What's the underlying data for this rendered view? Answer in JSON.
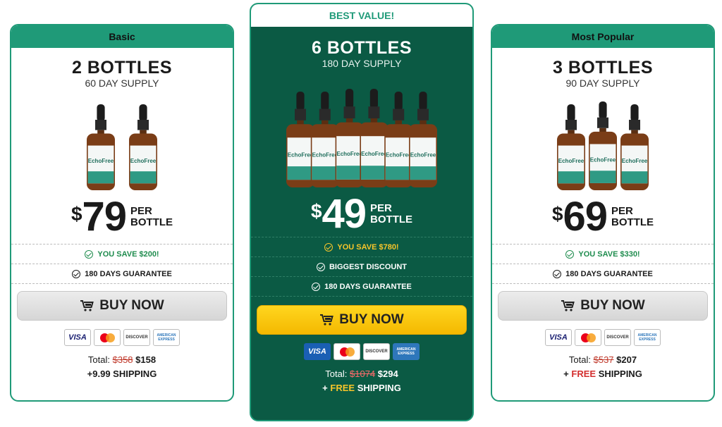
{
  "plans": {
    "basic": {
      "label": "Basic",
      "title": "2 BOTTLES",
      "supply": "60 DAY SUPPLY",
      "price_symbol": "$",
      "price": "79",
      "per1": "PER",
      "per2": "BOTTLE",
      "savings": "YOU SAVE $200!",
      "guarantee": "180 DAYS GUARANTEE",
      "buy": "BUY NOW",
      "total_label": "Total:",
      "total_old": "$358",
      "total_new": "$158",
      "shipping": "+9.99 SHIPPING",
      "bottle_count": 2
    },
    "best": {
      "label": "BEST VALUE!",
      "title": "6 BOTTLES",
      "supply": "180 DAY SUPPLY",
      "price_symbol": "$",
      "price": "49",
      "per1": "PER",
      "per2": "BOTTLE",
      "savings": "YOU SAVE $780!",
      "discount": "BIGGEST DISCOUNT",
      "guarantee": "180 DAYS GUARANTEE",
      "buy": "BUY NOW",
      "total_label": "Total:",
      "total_old": "$1074",
      "total_new": "$294",
      "shipping_plus": "+",
      "shipping_free": "FREE",
      "shipping_word": "SHIPPING",
      "bottle_count": 6
    },
    "popular": {
      "label": "Most Popular",
      "title": "3 BOTTLES",
      "supply": "90 DAY SUPPLY",
      "price_symbol": "$",
      "price": "69",
      "per1": "PER",
      "per2": "BOTTLE",
      "savings": "YOU SAVE $330!",
      "guarantee": "180 DAYS GUARANTEE",
      "buy": "BUY NOW",
      "total_label": "Total:",
      "total_old": "$537",
      "total_new": "$207",
      "shipping_plus": "+",
      "shipping_free": "FREE",
      "shipping_word": "SHIPPING",
      "bottle_count": 3
    }
  },
  "payment": {
    "visa": "VISA",
    "discover": "DISCOVER",
    "amex": "AMERICAN EXPRESS"
  },
  "product": {
    "brand": "EchoFree"
  },
  "colors": {
    "accent_green": "#1f9a78",
    "best_bg": "#0b5a44",
    "buy_yellow": "#f4b800",
    "free_red": "#d32f2f"
  }
}
